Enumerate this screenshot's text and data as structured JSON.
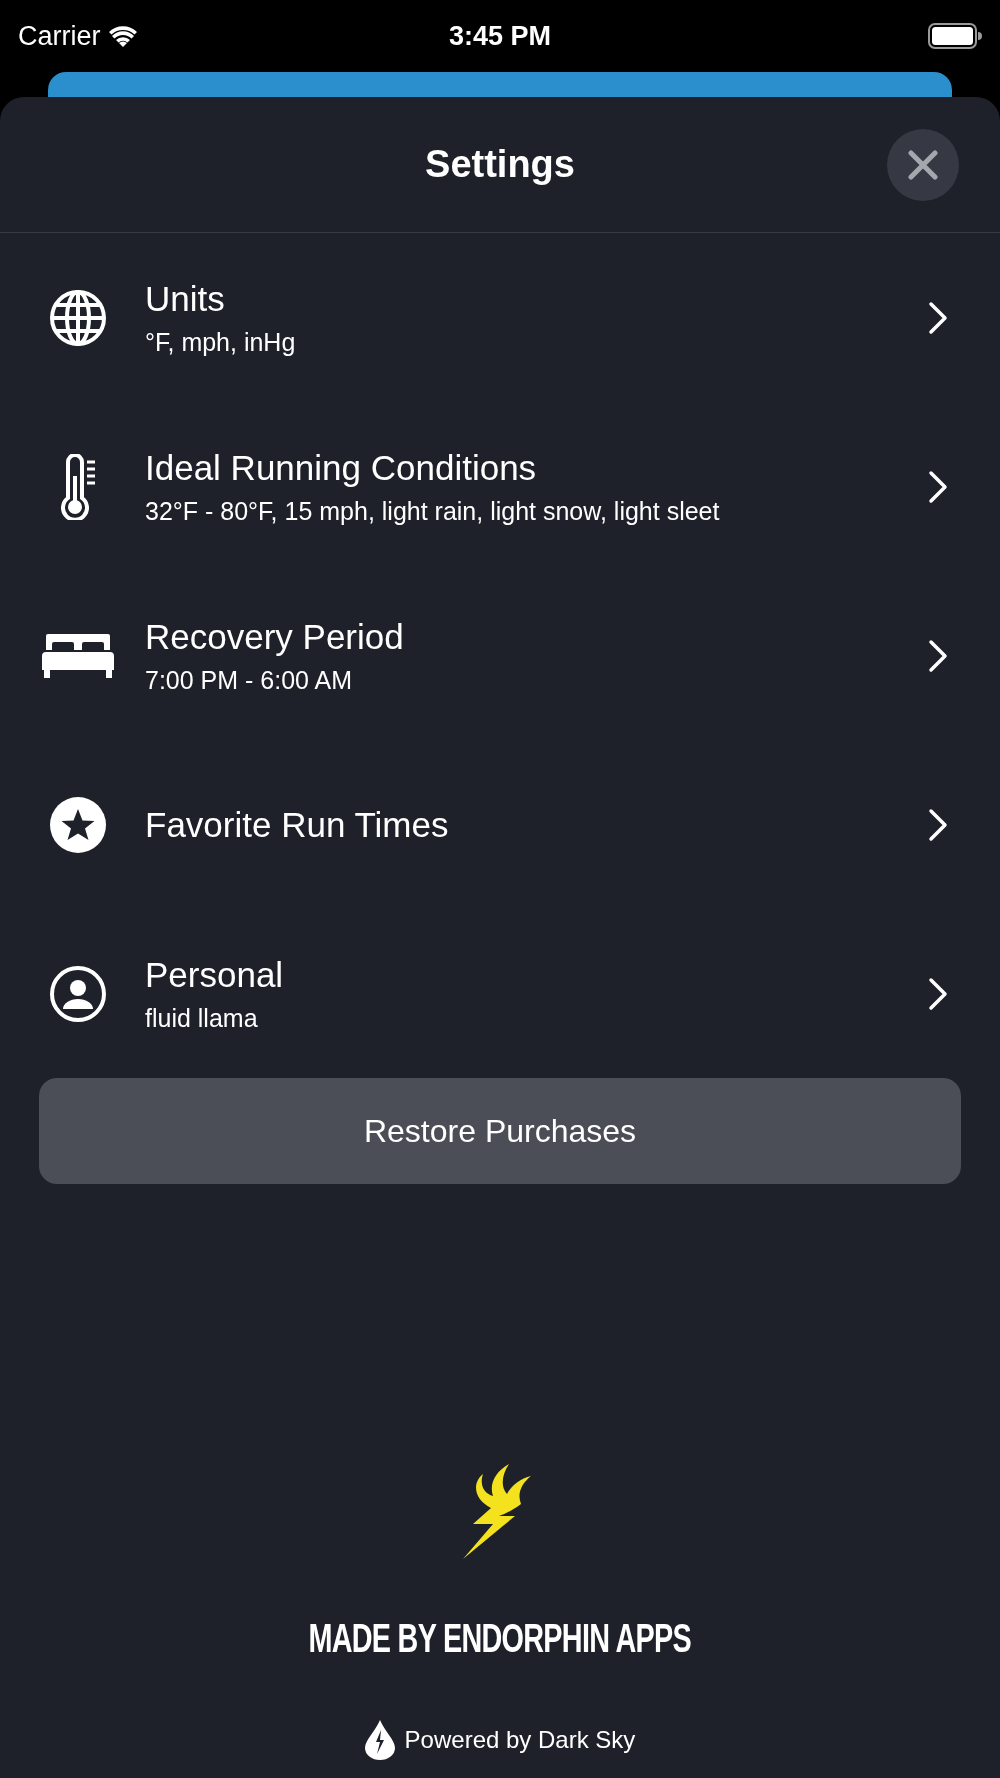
{
  "status_bar": {
    "carrier": "Carrier",
    "time": "3:45 PM"
  },
  "header": {
    "title": "Settings"
  },
  "rows": [
    {
      "kind": "globe",
      "title": "Units",
      "subtitle": "°F, mph, inHg"
    },
    {
      "kind": "thermometer",
      "title": "Ideal Running Conditions",
      "subtitle": "32°F - 80°F, 15 mph, light rain, light snow, light sleet"
    },
    {
      "kind": "bed",
      "title": "Recovery Period",
      "subtitle": "7:00 PM - 6:00 AM"
    },
    {
      "kind": "star",
      "title": "Favorite Run Times"
    },
    {
      "kind": "person",
      "title": "Personal",
      "subtitle": "fluid llama"
    }
  ],
  "restore_button": "Restore Purchases",
  "footer": {
    "made_by": "MADE BY ENDORPHIN APPS",
    "powered_by": "Powered by Dark Sky"
  }
}
